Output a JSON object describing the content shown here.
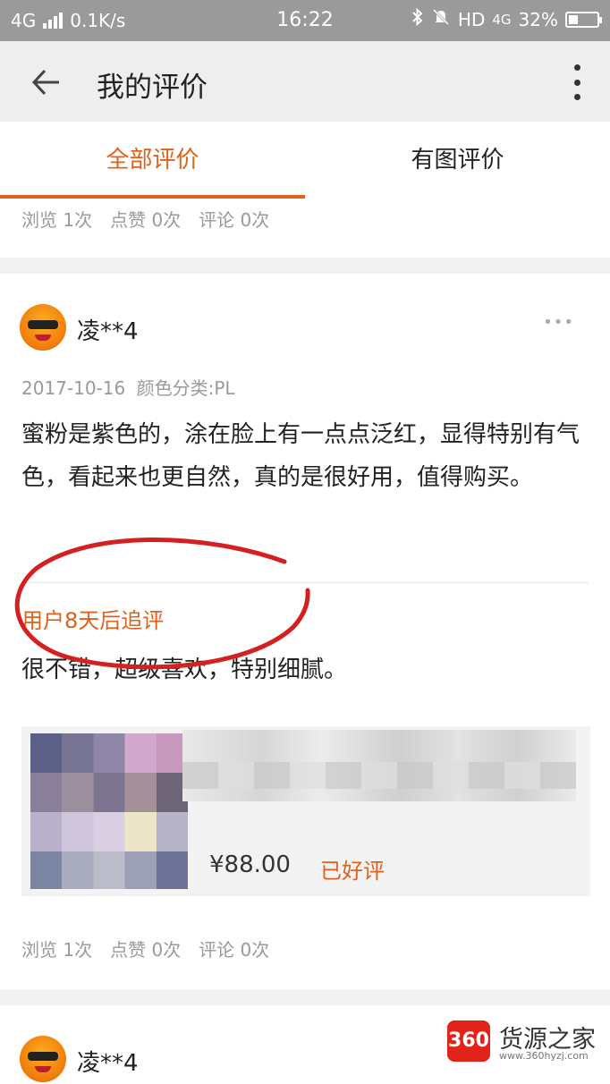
{
  "status_bar": {
    "network": "4G",
    "speed": "0.1K/s",
    "time": "16:22",
    "hd": "HD",
    "network2": "4G",
    "battery": "32%",
    "battery_level": 0.32
  },
  "header": {
    "title": "我的评价",
    "back_icon": "arrow-left-icon",
    "more_icon": "more-vertical-icon"
  },
  "tabs": [
    {
      "label": "全部评价",
      "active": true
    },
    {
      "label": "有图评价",
      "active": false
    }
  ],
  "accent_color": "#e0611b",
  "reviews": [
    {
      "stats": {
        "views": "浏览 1次",
        "likes": "点赞 0次",
        "comments": "评论 0次"
      }
    },
    {
      "user": "凌**4",
      "date": "2017-10-16",
      "variant": "颜色分类:PL",
      "content": "蜜粉是紫色的，涂在脸上有一点点泛红，显得特别有气色，看起来也更自然，真的是很好用，值得购买。",
      "followup_title": "用户8天后追评",
      "followup_text": "很不错，超级喜欢，特别细腻。",
      "product": {
        "price": "¥88.00",
        "rating": "已好评"
      },
      "stats": {
        "views": "浏览 1次",
        "likes": "点赞 0次",
        "comments": "评论 0次"
      }
    },
    {
      "user": "凌**4"
    }
  ],
  "watermark": {
    "logo": "360",
    "name": "货源之家",
    "url": "www.360hyzj.com"
  }
}
